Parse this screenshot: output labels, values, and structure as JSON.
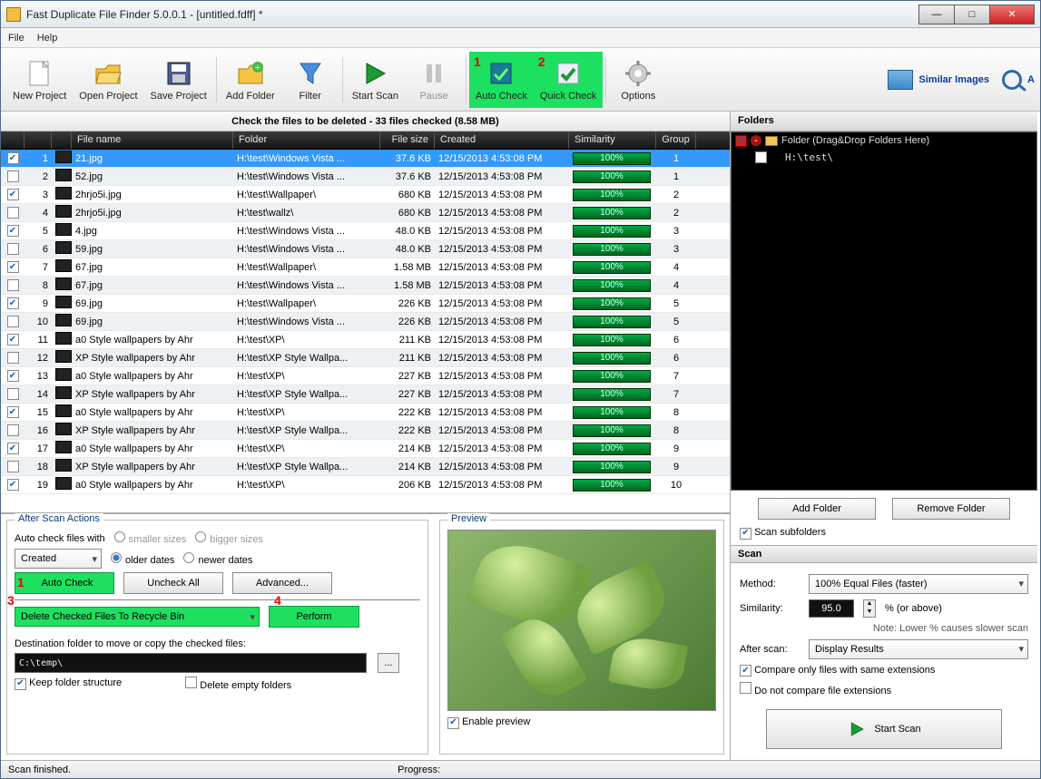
{
  "window": {
    "title": "Fast Duplicate File Finder 5.0.0.1 - [untitled.fdff] *"
  },
  "menu": {
    "file": "File",
    "help": "Help"
  },
  "toolbar": {
    "new": "New Project",
    "open": "Open Project",
    "save": "Save Project",
    "add": "Add Folder",
    "filter": "Filter",
    "start": "Start Scan",
    "pause": "Pause",
    "auto": "Auto Check",
    "quick": "Quick Check",
    "options": "Options",
    "similar": "Similar Images",
    "audio": "A"
  },
  "annot": {
    "t1": "1",
    "t2": "2",
    "b1": "1",
    "b3": "3",
    "b4": "4"
  },
  "info": "Check the files to be deleted - 33 files checked (8.58 MB)",
  "cols": {
    "chk": "",
    "name": "File name",
    "folder": "Folder",
    "size": "File size",
    "created": "Created",
    "sim": "Similarity",
    "grp": "Group"
  },
  "rows": [
    {
      "chk": true,
      "n": 1,
      "name": "21.jpg",
      "folder": "H:\\test\\Windows Vista ...",
      "size": "37.6 KB",
      "date": "12/15/2013 4:53:08 PM",
      "sim": "100%",
      "grp": 1,
      "sel": true
    },
    {
      "chk": false,
      "n": 2,
      "name": "52.jpg",
      "folder": "H:\\test\\Windows Vista ...",
      "size": "37.6 KB",
      "date": "12/15/2013 4:53:08 PM",
      "sim": "100%",
      "grp": 1
    },
    {
      "chk": true,
      "n": 3,
      "name": "2hrjo5i.jpg",
      "folder": "H:\\test\\Wallpaper\\",
      "size": "680 KB",
      "date": "12/15/2013 4:53:08 PM",
      "sim": "100%",
      "grp": 2
    },
    {
      "chk": false,
      "n": 4,
      "name": "2hrjo5i.jpg",
      "folder": "H:\\test\\wallz\\",
      "size": "680 KB",
      "date": "12/15/2013 4:53:08 PM",
      "sim": "100%",
      "grp": 2
    },
    {
      "chk": true,
      "n": 5,
      "name": "4.jpg",
      "folder": "H:\\test\\Windows Vista ...",
      "size": "48.0 KB",
      "date": "12/15/2013 4:53:08 PM",
      "sim": "100%",
      "grp": 3
    },
    {
      "chk": false,
      "n": 6,
      "name": "59.jpg",
      "folder": "H:\\test\\Windows Vista ...",
      "size": "48.0 KB",
      "date": "12/15/2013 4:53:08 PM",
      "sim": "100%",
      "grp": 3
    },
    {
      "chk": true,
      "n": 7,
      "name": "67.jpg",
      "folder": "H:\\test\\Wallpaper\\",
      "size": "1.58 MB",
      "date": "12/15/2013 4:53:08 PM",
      "sim": "100%",
      "grp": 4
    },
    {
      "chk": false,
      "n": 8,
      "name": "67.jpg",
      "folder": "H:\\test\\Windows Vista ...",
      "size": "1.58 MB",
      "date": "12/15/2013 4:53:08 PM",
      "sim": "100%",
      "grp": 4
    },
    {
      "chk": true,
      "n": 9,
      "name": "69.jpg",
      "folder": "H:\\test\\Wallpaper\\",
      "size": "226 KB",
      "date": "12/15/2013 4:53:08 PM",
      "sim": "100%",
      "grp": 5
    },
    {
      "chk": false,
      "n": 10,
      "name": "69.jpg",
      "folder": "H:\\test\\Windows Vista ...",
      "size": "226 KB",
      "date": "12/15/2013 4:53:08 PM",
      "sim": "100%",
      "grp": 5
    },
    {
      "chk": true,
      "n": 11,
      "name": "a0 Style wallpapers by Ahr",
      "folder": "H:\\test\\XP\\",
      "size": "211 KB",
      "date": "12/15/2013 4:53:08 PM",
      "sim": "100%",
      "grp": 6
    },
    {
      "chk": false,
      "n": 12,
      "name": "XP Style wallpapers by Ahr",
      "folder": "H:\\test\\XP Style Wallpa...",
      "size": "211 KB",
      "date": "12/15/2013 4:53:08 PM",
      "sim": "100%",
      "grp": 6
    },
    {
      "chk": true,
      "n": 13,
      "name": "a0 Style wallpapers by Ahr",
      "folder": "H:\\test\\XP\\",
      "size": "227 KB",
      "date": "12/15/2013 4:53:08 PM",
      "sim": "100%",
      "grp": 7
    },
    {
      "chk": false,
      "n": 14,
      "name": "XP Style wallpapers by Ahr",
      "folder": "H:\\test\\XP Style Wallpa...",
      "size": "227 KB",
      "date": "12/15/2013 4:53:08 PM",
      "sim": "100%",
      "grp": 7
    },
    {
      "chk": true,
      "n": 15,
      "name": "a0 Style wallpapers by Ahr",
      "folder": "H:\\test\\XP\\",
      "size": "222 KB",
      "date": "12/15/2013 4:53:08 PM",
      "sim": "100%",
      "grp": 8
    },
    {
      "chk": false,
      "n": 16,
      "name": "XP Style wallpapers by Ahr",
      "folder": "H:\\test\\XP Style Wallpa...",
      "size": "222 KB",
      "date": "12/15/2013 4:53:08 PM",
      "sim": "100%",
      "grp": 8
    },
    {
      "chk": true,
      "n": 17,
      "name": "a0 Style wallpapers by Ahr",
      "folder": "H:\\test\\XP\\",
      "size": "214 KB",
      "date": "12/15/2013 4:53:08 PM",
      "sim": "100%",
      "grp": 9
    },
    {
      "chk": false,
      "n": 18,
      "name": "XP Style wallpapers by Ahr",
      "folder": "H:\\test\\XP Style Wallpa...",
      "size": "214 KB",
      "date": "12/15/2013 4:53:08 PM",
      "sim": "100%",
      "grp": 9
    },
    {
      "chk": true,
      "n": 19,
      "name": "a0 Style wallpapers by Ahr",
      "folder": "H:\\test\\XP\\",
      "size": "206 KB",
      "date": "12/15/2013 4:53:08 PM",
      "sim": "100%",
      "grp": 10
    }
  ],
  "after": {
    "legend": "After Scan Actions",
    "autoLabel": "Auto check files with",
    "smaller": "smaller sizes",
    "bigger": "bigger sizes",
    "createdCombo": "Created",
    "older": "older dates",
    "newer": "newer dates",
    "autoBtn": "Auto Check",
    "uncheck": "Uncheck All",
    "advanced": "Advanced...",
    "actionCombo": "Delete Checked Files To Recycle Bin",
    "perform": "Perform",
    "destLabel": "Destination folder to move or copy the checked files:",
    "destPath": "C:\\temp\\",
    "keep": "Keep folder structure",
    "delEmpty": "Delete empty folders"
  },
  "preview": {
    "legend": "Preview",
    "enable": "Enable preview"
  },
  "folders": {
    "title": "Folders",
    "root": "Folder (Drag&Drop Folders Here)",
    "item1": "H:\\test\\",
    "addBtn": "Add Folder",
    "removeBtn": "Remove Folder",
    "scanSub": "Scan subfolders"
  },
  "scan": {
    "title": "Scan",
    "methodLbl": "Method:",
    "method": "100% Equal Files (faster)",
    "simLbl": "Similarity:",
    "simVal": "95.0",
    "simSuffix": "%  (or above)",
    "note": "Note: Lower % causes slower scan",
    "afterLbl": "After scan:",
    "afterVal": "Display Results",
    "cmpExt": "Compare only files with same extensions",
    "noCmpExt": "Do not compare file extensions",
    "startBtn": "Start Scan"
  },
  "status": {
    "left": "Scan finished.",
    "progress": "Progress:"
  }
}
